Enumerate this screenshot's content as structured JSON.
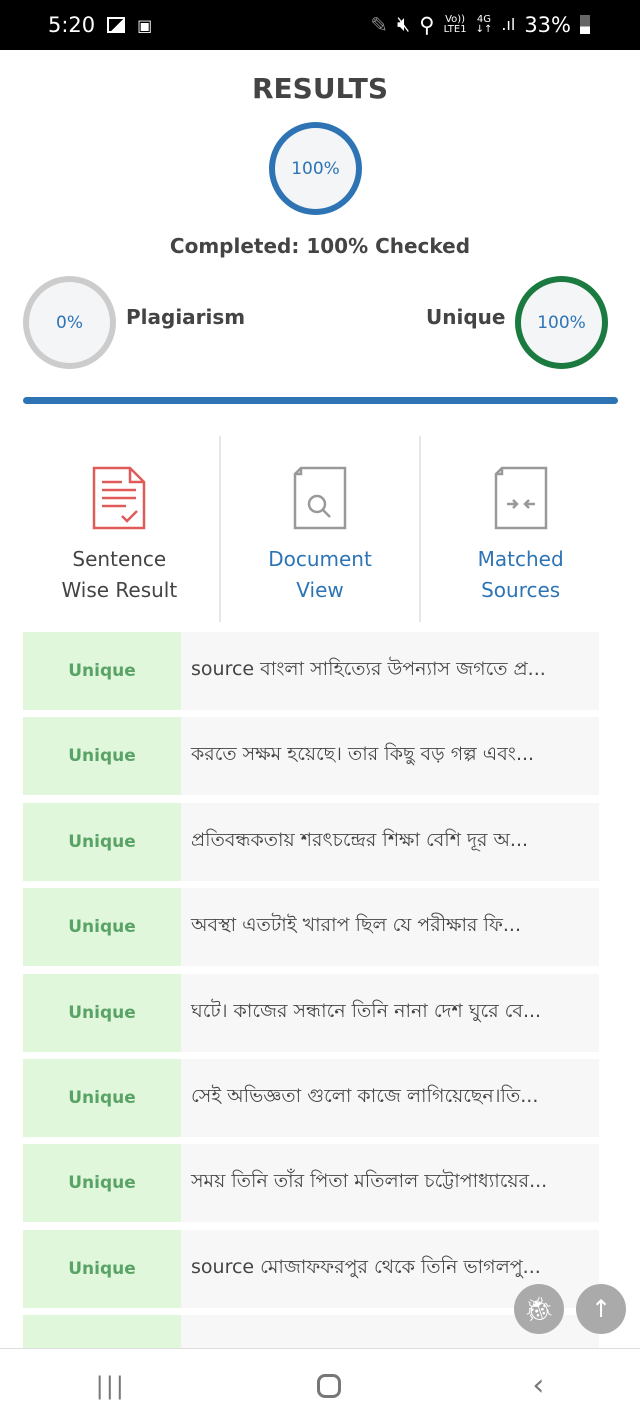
{
  "status_bar": {
    "time": "5:20",
    "battery": "33%",
    "volte": "Vo))",
    "lte": "LTE1",
    "network": "4G"
  },
  "header": {
    "title": "RESULTS",
    "overall_percent": "100%",
    "completed_text": "Completed: 100% Checked"
  },
  "scores": {
    "plagiarism": {
      "label": "Plagiarism",
      "value": "0%",
      "color": "#cccccc"
    },
    "unique": {
      "label": "Unique",
      "value": "100%",
      "color": "#1a7a40"
    }
  },
  "progress": {
    "value": 100,
    "color": "#2e74b5"
  },
  "tabs": [
    {
      "label_line1": "Sentence",
      "label_line2": "Wise Result",
      "icon": "document-check-icon",
      "active": true
    },
    {
      "label_line1": "Document",
      "label_line2": "View",
      "icon": "document-search-icon"
    },
    {
      "label_line1": "Matched",
      "label_line2": "Sources",
      "icon": "document-compare-icon"
    }
  ],
  "sentences": [
    {
      "status": "Unique",
      "text": "source বাংলা সাহিত্যের উপন্যাস জগতে প্র..."
    },
    {
      "status": "Unique",
      "text": "করতে সক্ষম হয়েছে। তার কিছু বড় গল্প এবং..."
    },
    {
      "status": "Unique",
      "text": "প্রতিবন্ধকতায় শরৎচন্দ্রের শিক্ষা বেশি দূর অ..."
    },
    {
      "status": "Unique",
      "text": "অবস্থা এতটাই খারাপ ছিল যে পরীক্ষার ফি..."
    },
    {
      "status": "Unique",
      "text": "ঘটে। কাজের সন্ধানে তিনি নানা দেশ ঘুরে বে..."
    },
    {
      "status": "Unique",
      "text": "সেই অভিজ্ঞতা গুলো কাজে লাগিয়েছেন।তি..."
    },
    {
      "status": "Unique",
      "text": "সময় তিনি তাঁর পিতা মতিলাল চট্টোপাধ্যায়ের..."
    },
    {
      "status": "Unique",
      "text": "source মোজাফফরপুর থেকে তিনি ভাগলপু..."
    },
    {
      "status": "",
      "text": ""
    }
  ],
  "fabs": {
    "bug": "bug-icon",
    "scroll_top": "↑"
  }
}
